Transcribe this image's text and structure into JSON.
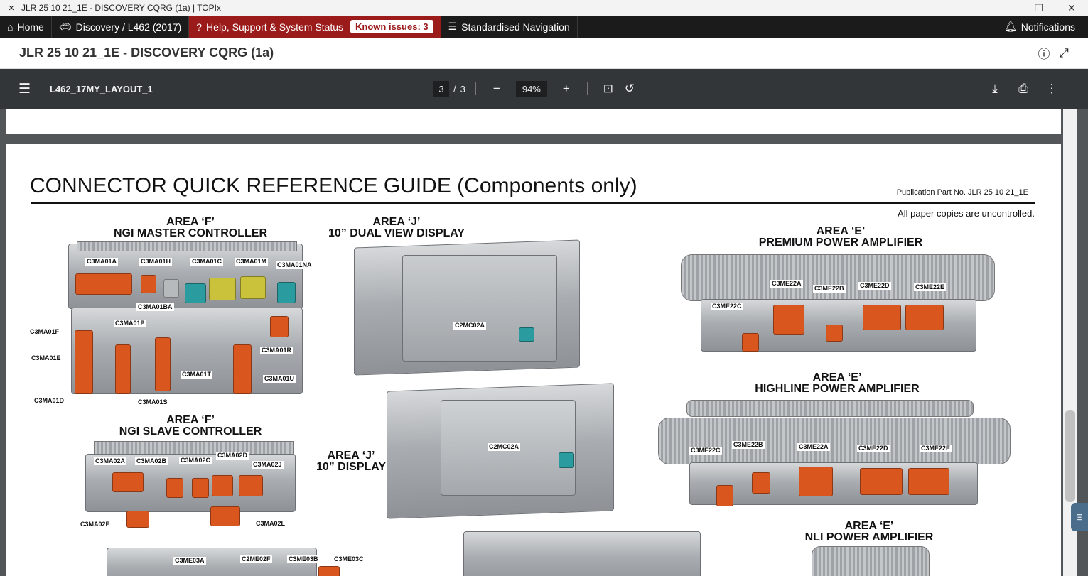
{
  "window": {
    "app_icon": "topix-logo-icon",
    "title": "JLR 25 10 21_1E - DISCOVERY CQRG (1a) | TOPIx",
    "minimize": "—",
    "maximize": "❐",
    "close": "✕"
  },
  "nav": {
    "home": "Home",
    "vehicle": "Discovery / L462 (2017)",
    "help": "Help, Support & System Status",
    "known_issues": "Known issues: 3",
    "standardised": "Standardised Navigation",
    "notifications": "Notifications"
  },
  "doc": {
    "title": "JLR 25 10 21_1E - DISCOVERY CQRG (1a)",
    "info_icon": "info-icon",
    "fullscreen_icon": "fullscreen-icon"
  },
  "pdf": {
    "filename": "L462_17MY_LAYOUT_1",
    "page_current": "3",
    "page_sep": "/",
    "page_total": "3",
    "zoom": "94%",
    "minus": "−",
    "plus": "+"
  },
  "page": {
    "title": "CONNECTOR QUICK REFERENCE GUIDE  (Components only)",
    "publication": "Publication Part No. JLR 25 10 21_1E",
    "uncontrolled": "All paper copies are uncontrolled.",
    "areas": {
      "master_area": "AREA ‘F’",
      "master_name": "NGI MASTER CONTROLLER",
      "slave_area": "AREA ‘F’",
      "slave_name": "NGI SLAVE CONTROLLER",
      "dual_area": "AREA ‘J’",
      "dual_name": "10” DUAL VIEW DISPLAY",
      "display_area": "AREA ‘J’",
      "display_name": "10” DISPLAY",
      "premium_area": "AREA ‘E’",
      "premium_name": "PREMIUM POWER AMPLIFIER",
      "highline_area": "AREA ‘E’",
      "highline_name": "HIGHLINE POWER AMPLIFIER",
      "nli_area": "AREA ‘E’",
      "nli_name": "NLI POWER AMPLIFIER"
    },
    "labels": {
      "c3ma01a": "C3MA01A",
      "c3ma01h": "C3MA01H",
      "c3ma01c": "C3MA01C",
      "c3ma01m": "C3MA01M",
      "c3ma01na": "C3MA01NA",
      "c3ma01ba": "C3MA01BA",
      "c3ma01f": "C3MA01F",
      "c3ma01p": "C3MA01P",
      "c3ma01e": "C3MA01E",
      "c3ma01r": "C3MA01R",
      "c3ma01t": "C3MA01T",
      "c3ma01u": "C3MA01U",
      "c3ma01d": "C3MA01D",
      "c3ma01s": "C3MA01S",
      "c3ma02a": "C3MA02A",
      "c3ma02b": "C3MA02B",
      "c3ma02c": "C3MA02C",
      "c3ma02d": "C3MA02D",
      "c3ma02j": "C3MA02J",
      "c3ma02e": "C3MA02E",
      "c3ma02l": "C3MA02L",
      "c3me03a": "C3ME03A",
      "c2me02f": "C2ME02F",
      "c3me03b": "C3ME03B",
      "c3me03c": "C3ME03C",
      "c2mc02a_dual": "C2MC02A",
      "c2mc02a_disp": "C2MC02A",
      "p_c3me22a": "C3ME22A",
      "p_c3me22b": "C3ME22B",
      "p_c3me22d": "C3ME22D",
      "p_c3me22e": "C3ME22E",
      "p_c3me22c": "C3ME22C",
      "h_c3me22c": "C3ME22C",
      "h_c3me22b": "C3ME22B",
      "h_c3me22a": "C3ME22A",
      "h_c3me22d": "C3ME22D",
      "h_c3me22e": "C3ME22E"
    }
  },
  "colors": {
    "connector_orange": "#d9561f",
    "connector_yellow": "#c9c23a",
    "connector_teal": "#2a9b9e",
    "help_red": "#9b1b1b"
  }
}
